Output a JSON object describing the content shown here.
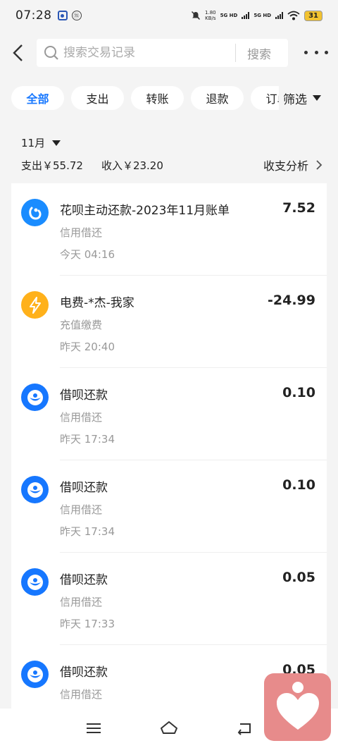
{
  "status_bar": {
    "time": "07:28",
    "speed": "1.80",
    "speed_unit": "KB/s",
    "net1": "5G HD",
    "net2": "5G HD",
    "battery": "31"
  },
  "search": {
    "placeholder": "搜索交易记录",
    "button_label": "搜索"
  },
  "filters": {
    "chips": [
      "全部",
      "支出",
      "转账",
      "退款",
      "订单"
    ],
    "active_index": 0,
    "filter_label": "筛选"
  },
  "summary": {
    "month": "11月",
    "expense": "支出￥55.72",
    "income": "收入￥23.20",
    "analysis_label": "收支分析"
  },
  "transactions": [
    {
      "title": "花呗主动还款-2023年11月账单",
      "category": "信用借还",
      "time": "今天 04:16",
      "amount": "7.52",
      "icon": "huabei-icon"
    },
    {
      "title": "电费-*杰-我家",
      "category": "充值缴费",
      "time": "昨天 20:40",
      "amount": "-24.99",
      "icon": "lightning-icon"
    },
    {
      "title": "借呗还款",
      "category": "信用借还",
      "time": "昨天 17:34",
      "amount": "0.10",
      "icon": "jiebei-icon"
    },
    {
      "title": "借呗还款",
      "category": "信用借还",
      "time": "昨天 17:34",
      "amount": "0.10",
      "icon": "jiebei-icon"
    },
    {
      "title": "借呗还款",
      "category": "信用借还",
      "time": "昨天 17:33",
      "amount": "0.05",
      "icon": "jiebei-icon"
    },
    {
      "title": "借呗还款",
      "category": "信用借还",
      "time": "",
      "amount": "0.05",
      "icon": "jiebei-icon"
    }
  ],
  "colors": {
    "accent": "#1677ff",
    "huabei": "#1a8cff",
    "electric": "#ffb11b",
    "jiebei": "#1677ff",
    "floating": "#e78b8b"
  }
}
